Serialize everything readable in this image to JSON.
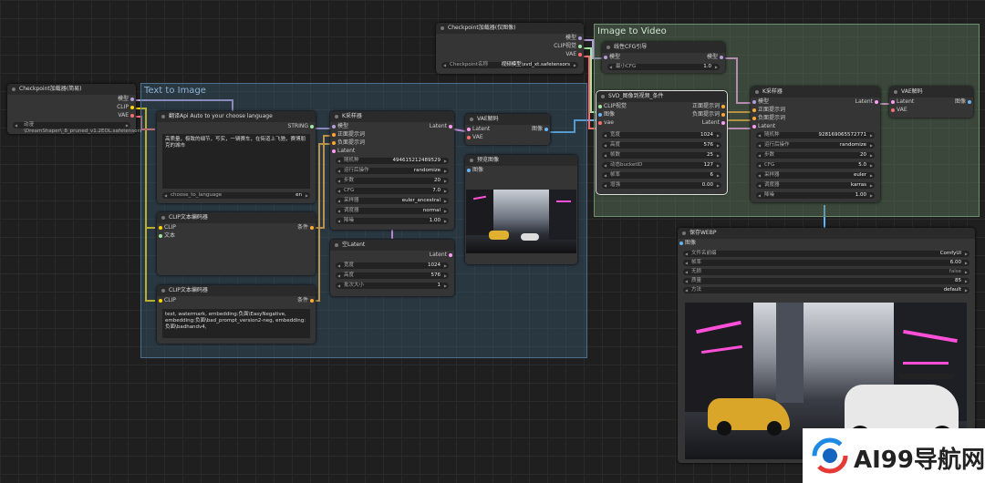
{
  "groups": {
    "text_to_image": "Text to Image",
    "image_to_video": "Image to Video"
  },
  "ckpt1": {
    "title": "Checkpoint加载器(简易)",
    "outputs": [
      "模型",
      "CLIP",
      "VAE"
    ],
    "ckpt_value": "动漫\\DreamShaper\\_8_pruned_v1.2EOL.safetensors"
  },
  "translate": {
    "title": "翻译Api Auto to your choose language",
    "output": "STRING",
    "text": "高质量，极致的细节，写实，一辆赛车，在街道上飞驰，赛博朋克的城市",
    "lang_label": "choose_to_language",
    "lang_value": "en"
  },
  "clip1": {
    "title": "CLIP文本编码器",
    "inputs": [
      "CLIP",
      "文本"
    ],
    "output": "条件"
  },
  "clip2": {
    "title": "CLIP文本编码器",
    "input": "CLIP",
    "output": "条件",
    "text": "text, watermark, embedding:负面\\EasyNegative, embedding:负面\\bad_prompt_version2-neg, embedding:负面\\badhandv4,"
  },
  "ksampler1": {
    "title": "K采样器",
    "inputs": [
      "模型",
      "正面提示词",
      "负面提示词",
      "Latent"
    ],
    "output": "Latent",
    "widgets": [
      {
        "label": "随机种",
        "value": "494615212489529"
      },
      {
        "label": "运行后操作",
        "value": "randomize"
      },
      {
        "label": "步数",
        "value": "20"
      },
      {
        "label": "CFG",
        "value": "7.0"
      },
      {
        "label": "采样器",
        "value": "euler_ancestral"
      },
      {
        "label": "调度器",
        "value": "normal"
      },
      {
        "label": "降噪",
        "value": "1.00"
      }
    ]
  },
  "latent": {
    "title": "空Latent",
    "output": "Latent",
    "widgets": [
      {
        "label": "宽度",
        "value": "1024"
      },
      {
        "label": "高度",
        "value": "576"
      },
      {
        "label": "批次大小",
        "value": "1"
      }
    ]
  },
  "vae1": {
    "title": "VAE解码",
    "inputs": [
      "Latent",
      "VAE"
    ],
    "output": "图像"
  },
  "preview": {
    "title": "预览图像",
    "input": "图像"
  },
  "ckpt2": {
    "title": "Checkpoint加载器(仅图像)",
    "outputs": [
      "模型",
      "CLIP视觉",
      "VAE"
    ],
    "ckpt_label": "Checkpoint名称",
    "ckpt_value": "视频模型\\svd_xt.safetensors"
  },
  "linear_cfg": {
    "title": "线性CFG引导",
    "input": "模型",
    "output": "模型",
    "widgets": [
      {
        "label": "最小CFG",
        "value": "1.0"
      }
    ]
  },
  "svd": {
    "title": "SVD_图像到视频_条件",
    "inputs": [
      "CLIP视觉",
      "图像",
      "vae"
    ],
    "outputs": [
      "正面提示词",
      "负面提示词",
      "Latent"
    ],
    "widgets": [
      {
        "label": "宽度",
        "value": "1024"
      },
      {
        "label": "高度",
        "value": "576"
      },
      {
        "label": "帧数",
        "value": "25"
      },
      {
        "label": "动态bucketID",
        "value": "127"
      },
      {
        "label": "帧率",
        "value": "6"
      },
      {
        "label": "增强",
        "value": "0.00"
      }
    ]
  },
  "ksampler2": {
    "title": "K采样器",
    "inputs": [
      "模型",
      "正面提示词",
      "负面提示词",
      "Latent"
    ],
    "output": "Latent",
    "widgets": [
      {
        "label": "随机种",
        "value": "928169065572771"
      },
      {
        "label": "运行后操作",
        "value": "randomize"
      },
      {
        "label": "步数",
        "value": "20"
      },
      {
        "label": "CFG",
        "value": "5.0"
      },
      {
        "label": "采样器",
        "value": "euler"
      },
      {
        "label": "调度器",
        "value": "karras"
      },
      {
        "label": "降噪",
        "value": "1.00"
      }
    ]
  },
  "vae2": {
    "title": "VAE解码",
    "inputs": [
      "Latent",
      "VAE"
    ],
    "output": "图像"
  },
  "save_webp": {
    "title": "保存WEBP",
    "input": "图像",
    "widgets": [
      {
        "label": "文件名前缀",
        "value": "ComfyUI"
      },
      {
        "label": "帧率",
        "value": "6.00"
      },
      {
        "label": "无损",
        "value": "false"
      },
      {
        "label": "质量",
        "value": "85"
      },
      {
        "label": "方法",
        "value": "default"
      }
    ]
  },
  "watermark": {
    "text": "AI99导航网"
  },
  "colors": {
    "clip": "#ffd500",
    "model": "#b39ddb",
    "vae": "#ff6e6e",
    "latent": "#ff9cf9",
    "image": "#64b5f6",
    "cond": "#ffa931"
  }
}
